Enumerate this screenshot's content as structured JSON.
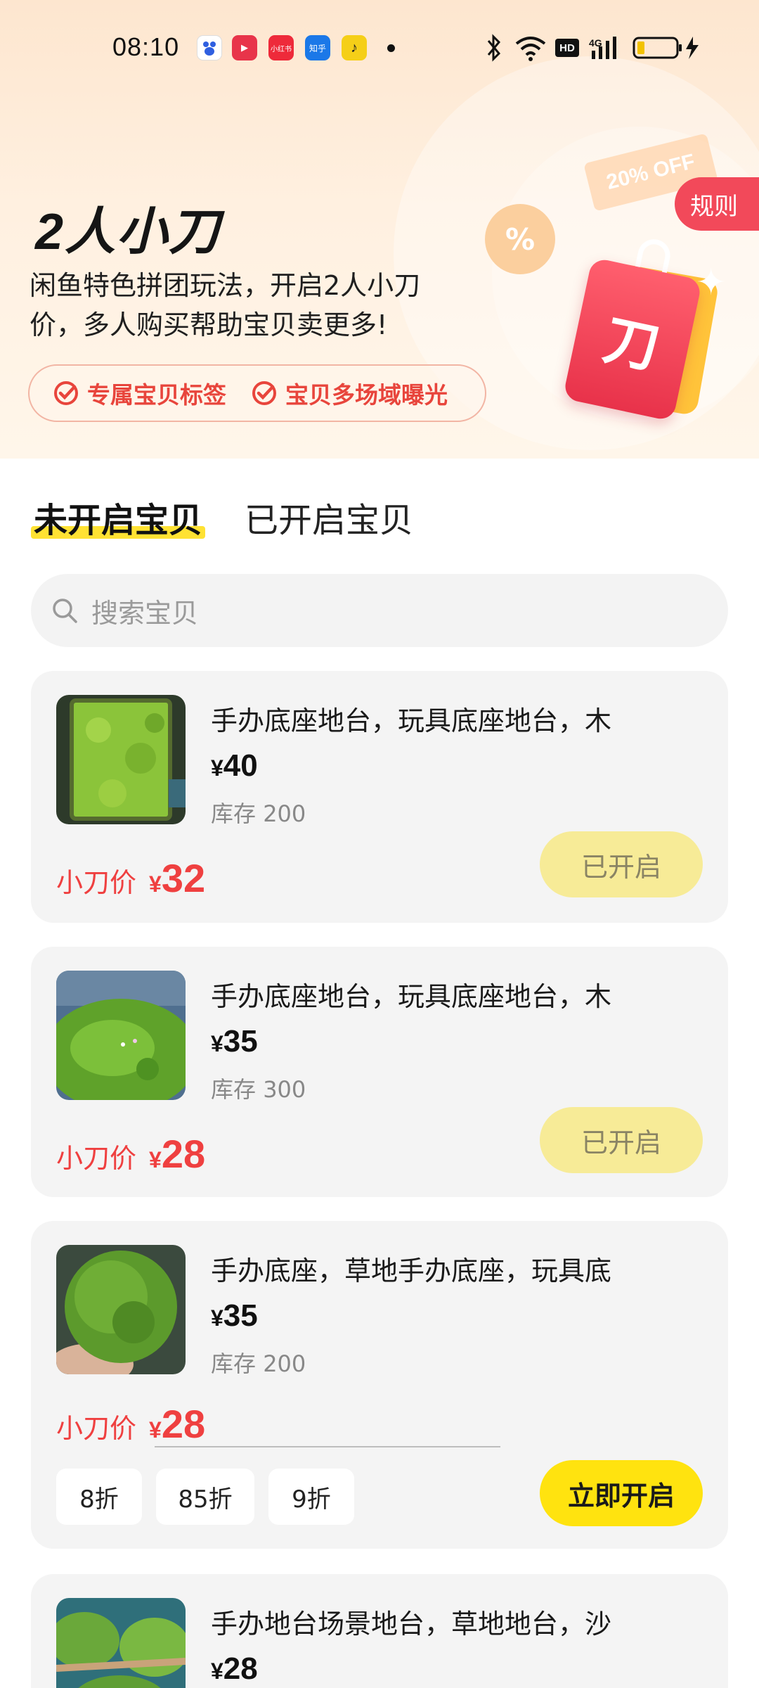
{
  "status_bar": {
    "time": "08:10",
    "apps": [
      {
        "name": "baidu-app-icon",
        "label": "",
        "color": "#ffffff"
      },
      {
        "name": "video-app-icon",
        "label": "▶",
        "color": "#e8344a"
      },
      {
        "name": "xiaohongshu-app-icon",
        "label": "小红书",
        "color": "#ee2a3a"
      },
      {
        "name": "zhihu-app-icon",
        "label": "知乎",
        "color": "#1b78e8"
      },
      {
        "name": "notes-app-icon",
        "label": "♪",
        "color": "#f5cf18"
      }
    ],
    "network_label": "HD",
    "signal_label": "4G"
  },
  "hero": {
    "title": "2人小刀",
    "description": "闲鱼特色拼团玩法，开启2人小刀价，多人购买帮助宝贝卖更多!",
    "features": [
      "专属宝贝标签",
      "宝贝多场域曝光"
    ],
    "rules_label": "规则",
    "coupon_text": "20% OFF",
    "percent_glyph": "%",
    "tag_glyph": "刀"
  },
  "tabs": [
    {
      "label": "未开启宝贝",
      "active": true
    },
    {
      "label": "已开启宝贝",
      "active": false
    }
  ],
  "search": {
    "placeholder": "搜索宝贝"
  },
  "cut_label": "小刀价",
  "currency": "¥",
  "stock_prefix": "库存",
  "items": [
    {
      "title": "手办底座地台，玩具底座地台，木",
      "price": "40",
      "stock": "200",
      "cut_price": "32",
      "status_label": "已开启",
      "opened": true
    },
    {
      "title": "手办底座地台，玩具底座地台，木",
      "price": "35",
      "stock": "300",
      "cut_price": "28",
      "status_label": "已开启",
      "opened": true
    },
    {
      "title": "手办底座，草地手办底座，玩具底",
      "price": "35",
      "stock": "200",
      "cut_price": "28",
      "status_label": "立即开启",
      "opened": false,
      "discounts": [
        "8折",
        "85折",
        "9折"
      ]
    },
    {
      "title": "手办地台场景地台，草地地台，沙",
      "price": "28"
    }
  ],
  "colors": {
    "accent_red": "#ef4040",
    "accent_yellow": "#ffe30f",
    "opened_button": "#f7eb97"
  }
}
